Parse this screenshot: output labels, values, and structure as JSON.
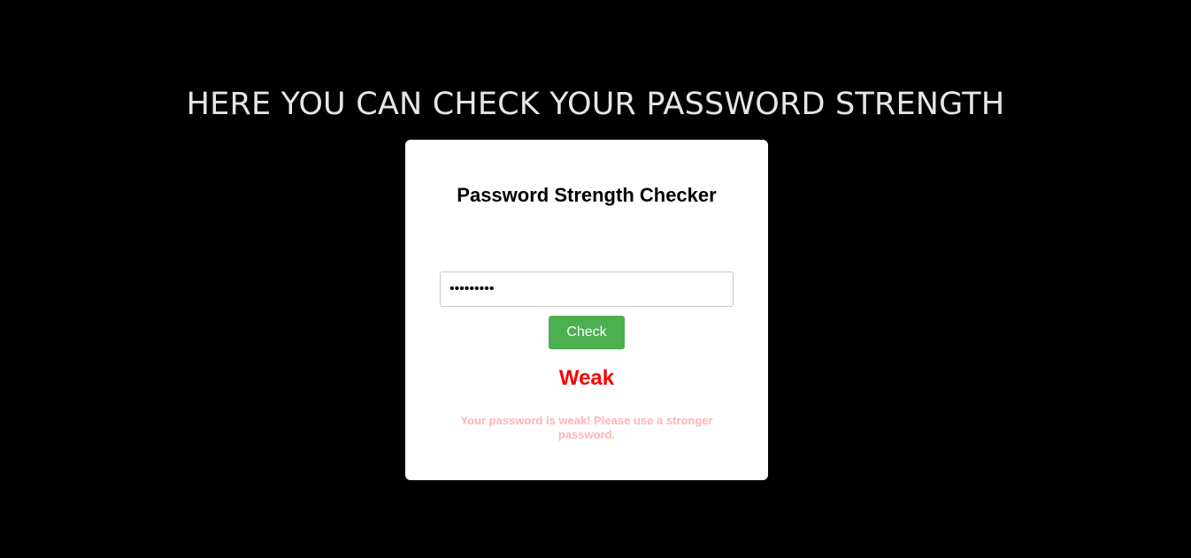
{
  "page": {
    "heading": "HERE YOU CAN CHECK YOUR PASSWORD STRENGTH"
  },
  "checker": {
    "title": "Password Strength Checker",
    "password_value": "•••••••••",
    "check_button_label": "Check",
    "strength": "Weak",
    "message": "Your password is weak! Please use a stronger password."
  },
  "colors": {
    "background": "#000000",
    "card": "#ffffff",
    "button": "#4caf50",
    "weak": "#ff0000",
    "message": "#ffb3b3"
  }
}
